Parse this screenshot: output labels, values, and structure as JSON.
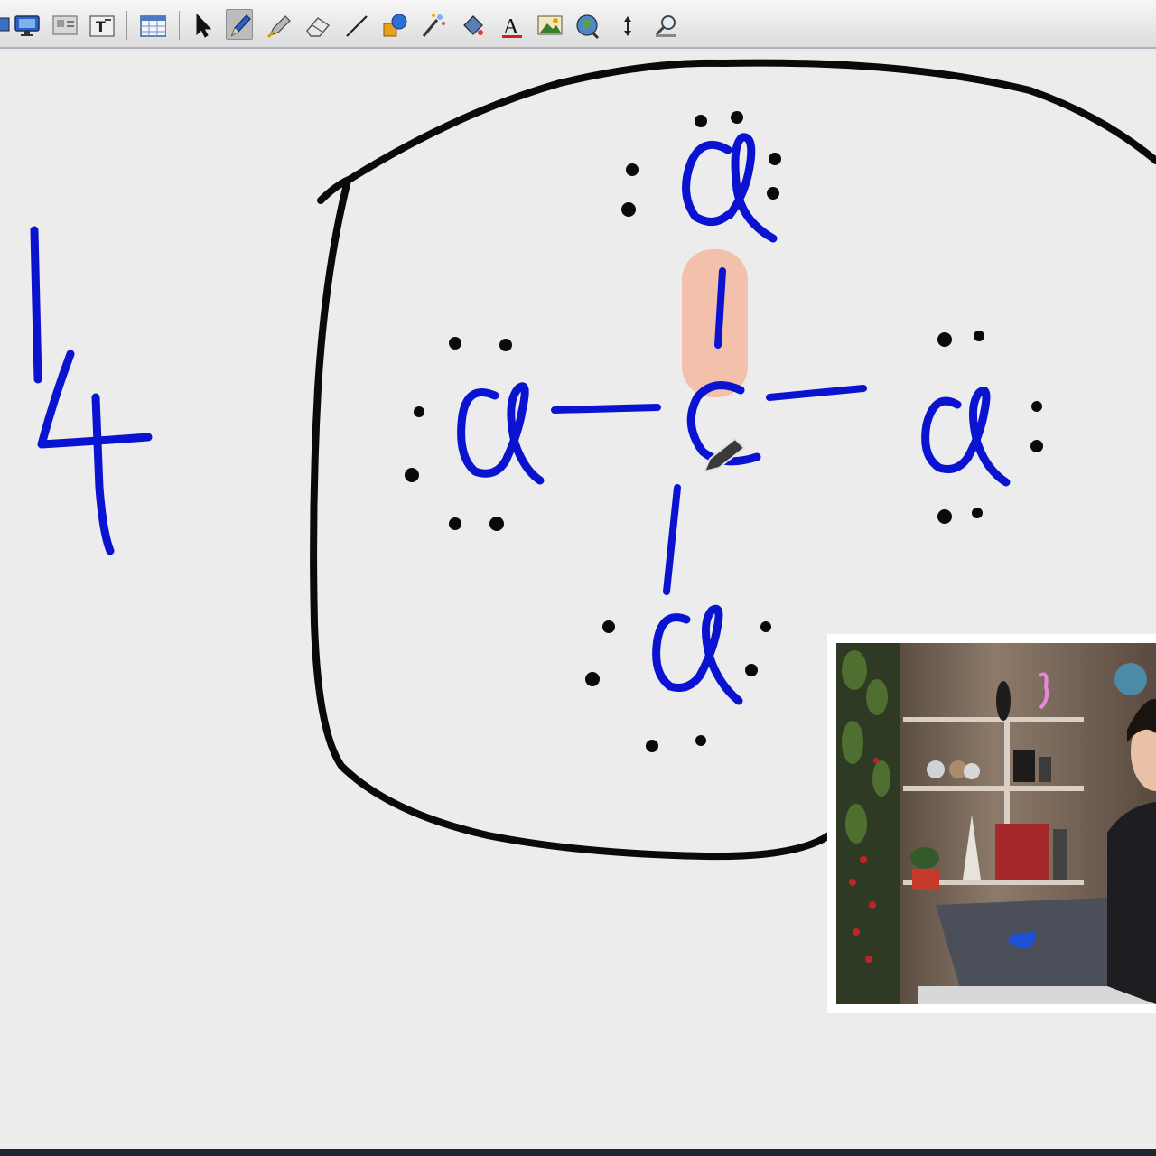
{
  "toolbar": {
    "tools": [
      {
        "name": "presentation-mode",
        "icon": "monitor-icon"
      },
      {
        "name": "slide-view",
        "icon": "image-slide-icon"
      },
      {
        "name": "text-frame",
        "icon": "text-box-icon"
      },
      {
        "name": "table",
        "icon": "table-icon"
      },
      {
        "name": "select",
        "icon": "cursor-arrow-icon"
      },
      {
        "name": "pen",
        "icon": "pen-icon",
        "active": true
      },
      {
        "name": "highlighter",
        "icon": "highlighter-icon"
      },
      {
        "name": "eraser",
        "icon": "eraser-icon"
      },
      {
        "name": "line",
        "icon": "line-icon"
      },
      {
        "name": "shapes",
        "icon": "shapes-icon"
      },
      {
        "name": "magic-wand",
        "icon": "magic-wand-icon"
      },
      {
        "name": "fill",
        "icon": "fill-bucket-icon"
      },
      {
        "name": "text",
        "icon": "text-a-icon",
        "label": "A"
      },
      {
        "name": "insert-image",
        "icon": "picture-icon"
      },
      {
        "name": "web-image",
        "icon": "globe-image-icon"
      },
      {
        "name": "insert-space",
        "icon": "vertical-arrows-icon"
      },
      {
        "name": "zoom",
        "icon": "magnifier-icon"
      }
    ]
  },
  "whiteboard": {
    "ink_colors": {
      "blue": "#0a14d0",
      "black": "#0a0a0a",
      "highlight": "#f4b9a0"
    },
    "left_digits": [
      "1",
      "4"
    ],
    "molecule": {
      "central_atom": "C",
      "substituents": [
        "Cl",
        "Cl",
        "Cl",
        "Cl"
      ],
      "bonds": 4,
      "highlighted_bond": "top"
    }
  },
  "webcam": {
    "label": "presenter-video",
    "laptop_logo_color": "#1d52d8"
  },
  "colors": {
    "toolbar_bg": "#e4e4e4",
    "canvas_bg": "#ececec",
    "ink_blue": "#0a14d0",
    "ink_black": "#0a0a0a"
  }
}
